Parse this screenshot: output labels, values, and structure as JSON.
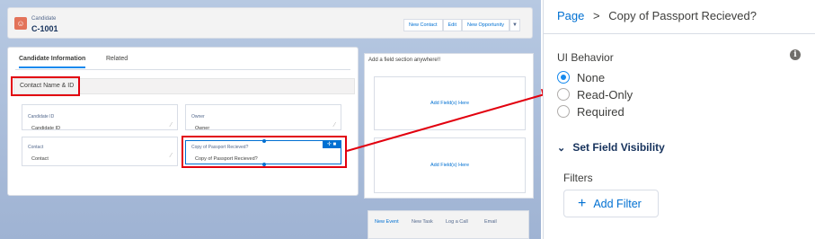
{
  "record": {
    "object_label": "Candidate",
    "record_name": "C-1001",
    "buttons": [
      "New Contact",
      "Edit",
      "New Opportunity"
    ]
  },
  "tabs": {
    "active": "Candidate Information",
    "other": "Related"
  },
  "section": {
    "title": "Contact Name & ID"
  },
  "fields": [
    {
      "label": "Candidate ID",
      "value": "Candidate ID"
    },
    {
      "label": "Owner",
      "value": "Owner"
    },
    {
      "label": "Contact",
      "value": "Contact"
    },
    {
      "label": "Copy of Passport Recieved?",
      "value": "Copy of Passport Recieved?"
    }
  ],
  "sidebar": {
    "section_title": "Add a field section anywhere!!",
    "drop1": "Add Field(s) Here",
    "drop2": "Add Field(s) Here"
  },
  "activity_tabs": [
    "New Event",
    "New Task",
    "Log a Call",
    "Email"
  ],
  "panel": {
    "breadcrumb_root": "Page",
    "breadcrumb_sep": ">",
    "breadcrumb_current": "Copy of Passport Recieved?",
    "ui_behavior_label": "UI Behavior",
    "options": [
      {
        "label": "None",
        "selected": true
      },
      {
        "label": "Read-Only",
        "selected": false
      },
      {
        "label": "Required",
        "selected": false
      }
    ],
    "set_field_visibility": "Set Field Visibility",
    "filters_label": "Filters",
    "add_filter": "Add Filter"
  },
  "colors": {
    "accent": "#0070d2",
    "annotation": "#e2000e",
    "record_icon": "#e3735a"
  }
}
